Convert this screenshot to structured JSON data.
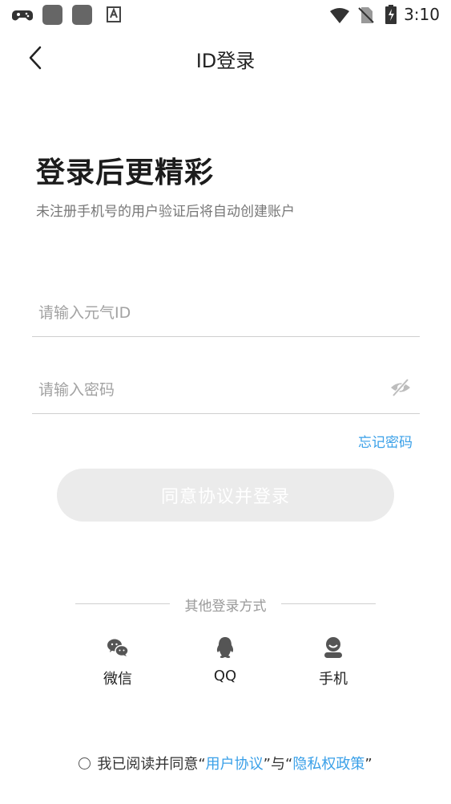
{
  "status_bar": {
    "time": "3:10",
    "icons": [
      "gamepad-icon",
      "app-icon",
      "app-icon",
      "keyboard-icon",
      "wifi-icon",
      "no-sim-icon",
      "battery-charging-icon"
    ]
  },
  "header": {
    "title": "ID登录"
  },
  "hero": {
    "headline": "登录后更精彩",
    "subhead": "未注册手机号的用户验证后将自动创建账户"
  },
  "form": {
    "id_placeholder": "请输入元气ID",
    "password_placeholder": "请输入密码",
    "forgot_label": "忘记密码",
    "login_button": "同意协议并登录"
  },
  "other_login": {
    "title": "其他登录方式",
    "options": [
      {
        "label": "微信",
        "icon": "wechat-icon"
      },
      {
        "label": "QQ",
        "icon": "qq-icon"
      },
      {
        "label": "手机",
        "icon": "phone-user-icon"
      }
    ]
  },
  "agreement": {
    "prefix": "我已阅读并同意",
    "quote_open": "“",
    "user_agreement": "用户协议",
    "mid": "”与“",
    "privacy_policy": "隐私权政策",
    "quote_close": "”"
  },
  "colors": {
    "accent": "#3aa0e8",
    "button_disabled": "#ebebeb"
  }
}
